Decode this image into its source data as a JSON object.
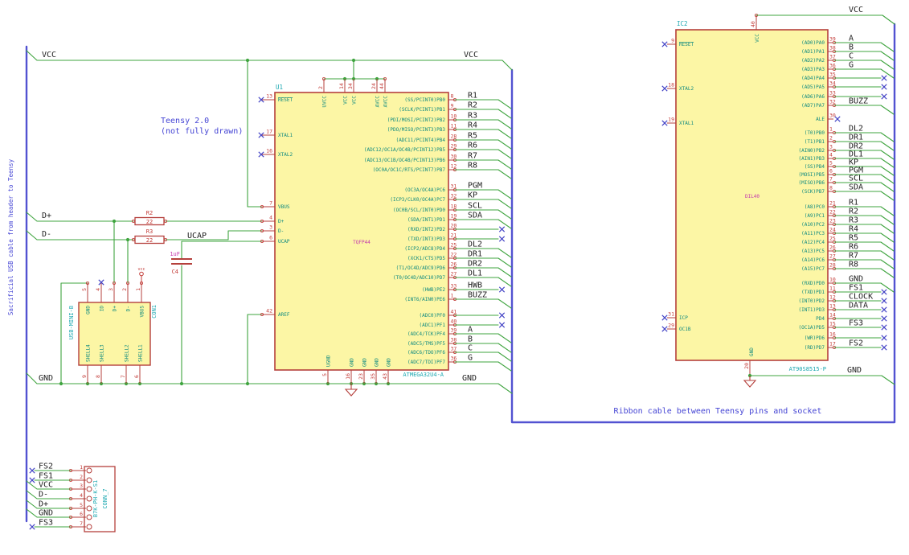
{
  "colors": {
    "background": "#ffffff",
    "wire": "#3fa43f",
    "bus": "#5252d1",
    "outline": "#b5403c",
    "fill": "#fcf6a5",
    "pin_number": "#c33c38",
    "pin_name": "#0f8a80",
    "reference": "#1aa7b0",
    "net_label": "#1e1e1e",
    "annotation": "#4444d4",
    "footprint": "#c438ad",
    "no_connect": "#4646c6"
  },
  "annotations": {
    "usb_cable_note": "Sacrificial USB cable from header to Teensy",
    "teensy_note_line1": "Teensy 2.0",
    "teensy_note_line2": "(not fully drawn)",
    "ribbon_note": "Ribbon cable between Teensy pins and socket"
  },
  "net_labels": {
    "vcc": "VCC",
    "gnd": "GND",
    "dplus": "D+",
    "dminus": "D-",
    "ucap": "UCAP"
  },
  "components": {
    "u1": {
      "reference": "U1",
      "value": "ATMEGA32U4-A",
      "footprint": "TQFP44",
      "top_pins": [
        {
          "num": "2",
          "name": "UVCC"
        },
        {
          "num": "14",
          "name": "VCC"
        },
        {
          "num": "34",
          "name": "VCC"
        },
        {
          "num": "24",
          "name": "AVCC"
        },
        {
          "num": "44",
          "name": "AVCC"
        }
      ],
      "bottom_pins": [
        {
          "num": "5",
          "name": "UGND"
        },
        {
          "num": "16",
          "name": "GND"
        },
        {
          "num": "23",
          "name": "GND"
        },
        {
          "num": "35",
          "name": "GND"
        },
        {
          "num": "43",
          "name": "GND"
        }
      ],
      "left_pins": [
        {
          "num": "13",
          "name": "RESET",
          "nc": true,
          "ov": true
        },
        {
          "num": "17",
          "name": "XTAL1",
          "nc": true
        },
        {
          "num": "16",
          "name": "XTAL2",
          "nc": true
        },
        {
          "num": "7",
          "name": "VBUS"
        },
        {
          "num": "4",
          "name": "D+"
        },
        {
          "num": "3",
          "name": "D-"
        },
        {
          "num": "6",
          "name": "UCAP"
        },
        {
          "num": "42",
          "name": "AREF"
        }
      ],
      "right_pins": [
        {
          "num": "8",
          "name": "(SS/PCINT0)PB0",
          "label": "R1"
        },
        {
          "num": "9",
          "name": "(SCLK/PCINT1)PB1",
          "label": "R2"
        },
        {
          "num": "10",
          "name": "(PDI/MOSI/PCINT2)PB2",
          "label": "R3"
        },
        {
          "num": "11",
          "name": "(PDO/MISO/PCINT3)PB3",
          "label": "R4"
        },
        {
          "num": "28",
          "name": "(ADC11/PCINT4)PB4",
          "label": "R5"
        },
        {
          "num": "29",
          "name": "(ADC12/OC1A/OC4B/PCINT12)PB5",
          "label": "R6"
        },
        {
          "num": "30",
          "name": "(ADC13/OC1B/OC4B/PCINT13)PB6",
          "label": "R7"
        },
        {
          "num": "12",
          "name": "(OC0A/OC1C/RTS/PCINT7)PB7",
          "label": "R8"
        },
        {
          "num": "31",
          "name": "(OC3A/OC4A)PC6",
          "label": "PGM"
        },
        {
          "num": "32",
          "name": "(ICP3/CLK0/OC4A)PC7",
          "label": "KP"
        },
        {
          "num": "18",
          "name": "(OC0B/SCL/INT0)PD0",
          "label": "SCL"
        },
        {
          "num": "19",
          "name": "(SDA/INT1)PD1",
          "label": "SDA"
        },
        {
          "num": "20",
          "name": "(RXD/INT2)PD2",
          "nc": true
        },
        {
          "num": "21",
          "name": "(TXD/INT3)PD3",
          "nc": true
        },
        {
          "num": "25",
          "name": "(ICP2/ADC8)PD4",
          "label": "DL2"
        },
        {
          "num": "22",
          "name": "(XCK1/CTS)PD5",
          "label": "DR1"
        },
        {
          "num": "26",
          "name": "(T1/OC4D/ADC9)PD6",
          "label": "DR2"
        },
        {
          "num": "27",
          "name": "(T0/OC4D/ADC10)PD7",
          "label": "DL1"
        },
        {
          "num": "33",
          "name": "(HWB)PE2",
          "label": "HWB",
          "nc": true
        },
        {
          "num": "1",
          "name": "(INT6/AIN0)PE6",
          "label": "BUZZ"
        },
        {
          "num": "41",
          "name": "(ADC0)PF0",
          "nc": true
        },
        {
          "num": "40",
          "name": "(ADC1)PF1",
          "nc": true
        },
        {
          "num": "39",
          "name": "(ADC4/TCK)PF4",
          "label": "A"
        },
        {
          "num": "38",
          "name": "(ADC5/TMS)PF5",
          "label": "B"
        },
        {
          "num": "37",
          "name": "(ADC6/TDO)PF6",
          "label": "C"
        },
        {
          "num": "36",
          "name": "(ADC7/TDI)PF7",
          "label": "G"
        }
      ]
    },
    "ic2": {
      "reference": "IC2",
      "value": "AT90S8515-P",
      "footprint": "DIL40",
      "top_pin": {
        "num": "40",
        "name": "VCC"
      },
      "bottom_pin": {
        "num": "20",
        "name": "GND"
      },
      "left_pins": [
        {
          "num": "9",
          "name": "RESET",
          "nc": true,
          "ov": true
        },
        {
          "num": "18",
          "name": "XTAL2",
          "nc": true
        },
        {
          "num": "19",
          "name": "XTAL1",
          "nc": true
        },
        {
          "num": "31",
          "name": "ICP",
          "nc": true
        },
        {
          "num": "29",
          "name": "OC1B",
          "nc": true
        }
      ],
      "right_pins": [
        {
          "num": "39",
          "name": "(AD0)PA0",
          "label": "A"
        },
        {
          "num": "38",
          "name": "(AD1)PA1",
          "label": "B"
        },
        {
          "num": "37",
          "name": "(AD2)PA2",
          "label": "C"
        },
        {
          "num": "36",
          "name": "(AD3)PA3",
          "label": "G"
        },
        {
          "num": "35",
          "name": "(AD4)PA4",
          "nc": true
        },
        {
          "num": "34",
          "name": "(AD5)PA5",
          "nc": true
        },
        {
          "num": "33",
          "name": "(AD6)PA6",
          "nc": true
        },
        {
          "num": "32",
          "name": "(AD7)PA7",
          "label": "BUZZ"
        },
        {
          "num": "30",
          "name": "ALE",
          "nc": true,
          "at_pin": true
        },
        {
          "num": "1",
          "name": "(T0)PB0",
          "label": "DL2"
        },
        {
          "num": "2",
          "name": "(T1)PB1",
          "label": "DR1"
        },
        {
          "num": "3",
          "name": "(AIN0)PB2",
          "label": "DR2"
        },
        {
          "num": "4",
          "name": "(AIN1)PB3",
          "label": "DL1"
        },
        {
          "num": "5",
          "name": "(SS)PB4",
          "label": "KP"
        },
        {
          "num": "6",
          "name": "(MOSI)PB5",
          "label": "PGM"
        },
        {
          "num": "7",
          "name": "(MISO)PB6",
          "label": "SCL"
        },
        {
          "num": "8",
          "name": "(SCK)PB7",
          "label": "SDA"
        },
        {
          "num": "21",
          "name": "(A8)PC0",
          "label": "R1"
        },
        {
          "num": "22",
          "name": "(A9)PC1",
          "label": "R2"
        },
        {
          "num": "23",
          "name": "(A10)PC2",
          "label": "R3"
        },
        {
          "num": "24",
          "name": "(A11)PC3",
          "label": "R4"
        },
        {
          "num": "25",
          "name": "(A12)PC4",
          "label": "R5"
        },
        {
          "num": "26",
          "name": "(A13)PC5",
          "label": "R6"
        },
        {
          "num": "27",
          "name": "(A14)PC6",
          "label": "R7"
        },
        {
          "num": "28",
          "name": "(A15)PC7",
          "label": "R8"
        },
        {
          "num": "10",
          "name": "(RXD)PD0",
          "label": "GND"
        },
        {
          "num": "11",
          "name": "(TXD)PD1",
          "label": "FS1",
          "nc": true
        },
        {
          "num": "12",
          "name": "(INT0)PD2",
          "label": "CLOCK",
          "nc": true
        },
        {
          "num": "13",
          "name": "(INT1)PD3",
          "label": "DATA",
          "nc": true
        },
        {
          "num": "14",
          "name": "PD4",
          "nc": true
        },
        {
          "num": "15",
          "name": "(OC1A)PD5",
          "label": "FS3",
          "nc": true
        },
        {
          "num": "16",
          "name": "(WR)PD6",
          "nc": true
        },
        {
          "num": "17",
          "name": "(RD)PD7",
          "label": "FS2",
          "nc": true
        }
      ]
    },
    "con1": {
      "reference": "CON1",
      "value": "USB-MINI-B",
      "top_pins": [
        {
          "num": "5",
          "name": "GND"
        },
        {
          "num": "4",
          "name": "ID",
          "nc": true
        },
        {
          "num": "3",
          "name": "D+"
        },
        {
          "num": "2",
          "name": "D-"
        },
        {
          "num": "1",
          "name": "VBUS"
        }
      ],
      "bottom_pins": [
        {
          "num": "9",
          "name": "SHELL4"
        },
        {
          "num": "8",
          "name": "SHELL3"
        },
        {
          "num": "7",
          "name": "SHELL2"
        },
        {
          "num": "6",
          "name": "SHELL1"
        }
      ]
    },
    "conn7": {
      "reference": "CONN_7",
      "value": "B7K-PH-K-S1",
      "pins": [
        {
          "num": "1",
          "label": "FS2",
          "nc": true
        },
        {
          "num": "2",
          "label": "FS1",
          "nc": true
        },
        {
          "num": "3",
          "label": "VCC"
        },
        {
          "num": "4",
          "label": "D-"
        },
        {
          "num": "5",
          "label": "D+"
        },
        {
          "num": "6",
          "label": "GND"
        },
        {
          "num": "7",
          "label": "FS3",
          "nc": true
        }
      ]
    },
    "r2": {
      "reference": "R2",
      "value": "22"
    },
    "r3": {
      "reference": "R3",
      "value": "22"
    },
    "c4": {
      "reference": "C4",
      "value": "1uF"
    },
    "vcc_flag": {
      "label": "vcc"
    }
  }
}
